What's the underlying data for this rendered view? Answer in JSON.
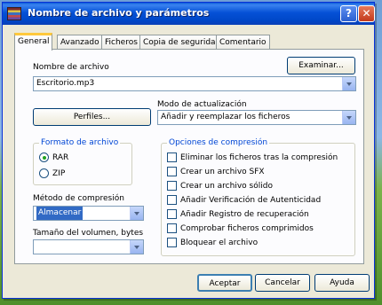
{
  "window": {
    "title": "Nombre de archivo y parámetros"
  },
  "tabs": [
    "General",
    "Avanzado",
    "Ficheros",
    "Copia de seguridad",
    "Comentario"
  ],
  "filename": {
    "label": "Nombre de archivo",
    "value": "Escritorio.mp3",
    "browse_label": "Examinar..."
  },
  "profiles": {
    "label": "Perfiles..."
  },
  "update_mode": {
    "label": "Modo de actualización",
    "value": "Añadir y reemplazar los ficheros"
  },
  "archive_format": {
    "title": "Formato de archivo",
    "options": [
      "RAR",
      "ZIP"
    ],
    "selected": "RAR"
  },
  "compression_method": {
    "label": "Método de compresión",
    "value": "Almacenar"
  },
  "volume_size": {
    "label": "Tamaño del volumen, bytes",
    "value": ""
  },
  "compression_options": {
    "title": "Opciones de compresión",
    "items": [
      "Eliminar los ficheros tras la compresión",
      "Crear un archivo SFX",
      "Crear un archivo sólido",
      "Añadir Verificación de Autenticidad",
      "Añadir Registro de recuperación",
      "Comprobar ficheros comprimidos",
      "Bloquear el archivo"
    ],
    "checked": [
      false,
      false,
      false,
      false,
      false,
      false,
      false
    ]
  },
  "buttons": {
    "accept": "Aceptar",
    "cancel": "Cancelar",
    "help": "Ayuda"
  },
  "icons": {
    "title": "winrar-books-icon",
    "help": "question-mark-icon",
    "close": "close-x-icon"
  },
  "colors": {
    "titlebar": "#0551d6",
    "accent": "#316ac5",
    "group_title": "#0046d5"
  }
}
